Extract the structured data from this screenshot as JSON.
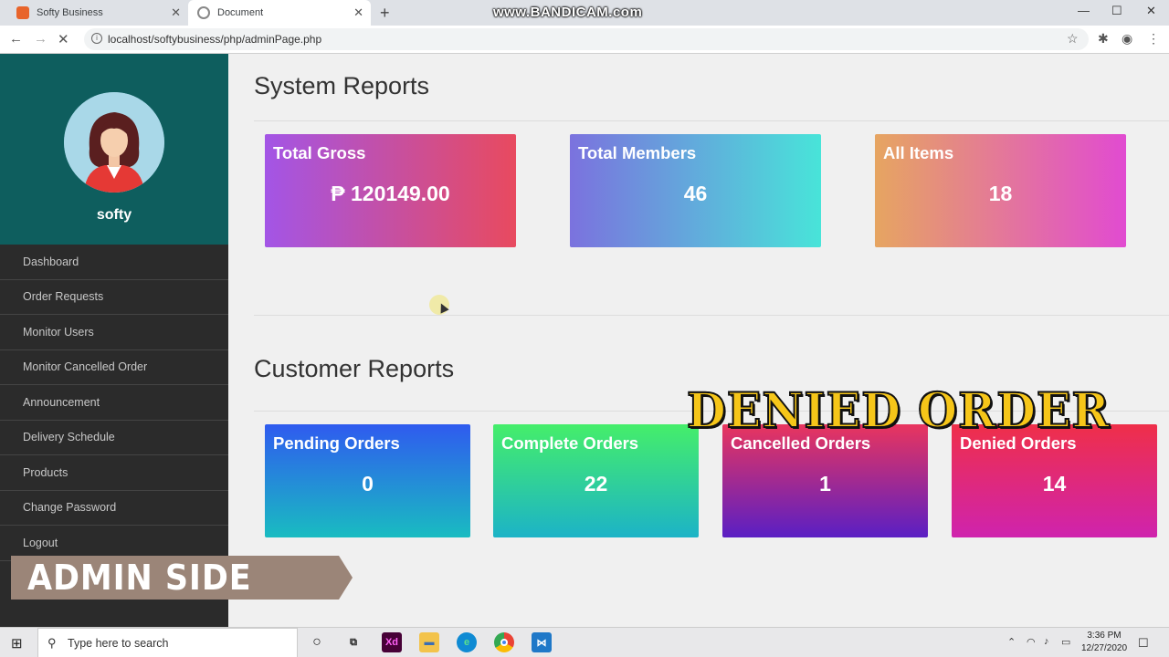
{
  "browser": {
    "tabs": [
      {
        "title": "Softy Business",
        "icon": "xampp-icon"
      },
      {
        "title": "Document",
        "icon": "page-icon"
      }
    ],
    "watermark": "www.BANDICAM.com",
    "url": "localhost/softybusiness/php/adminPage.php"
  },
  "sidebar": {
    "username": "softy",
    "items": [
      {
        "label": "Dashboard"
      },
      {
        "label": "Order Requests"
      },
      {
        "label": "Monitor Users"
      },
      {
        "label": "Monitor Cancelled Order"
      },
      {
        "label": "Announcement"
      },
      {
        "label": "Delivery Schedule"
      },
      {
        "label": "Products"
      },
      {
        "label": "Change Password"
      },
      {
        "label": "Logout"
      }
    ]
  },
  "overlays": {
    "admin_side": "ADMIN SIDE",
    "denied_order": "DENIED ORDER"
  },
  "system_reports": {
    "title": "System Reports",
    "cards": [
      {
        "label": "Total Gross",
        "value": "₱ 120149.00"
      },
      {
        "label": "Total Members",
        "value": "46"
      },
      {
        "label": "All Items",
        "value": "18"
      }
    ]
  },
  "customer_reports": {
    "title": "Customer Reports",
    "cards": [
      {
        "label": "Pending Orders",
        "value": "0"
      },
      {
        "label": "Complete Orders",
        "value": "22"
      },
      {
        "label": "Cancelled Orders",
        "value": "1"
      },
      {
        "label": "Denied Orders",
        "value": "14"
      }
    ]
  },
  "taskbar": {
    "search_placeholder": "Type here to search",
    "time": "3:36 PM",
    "date": "12/27/2020"
  }
}
